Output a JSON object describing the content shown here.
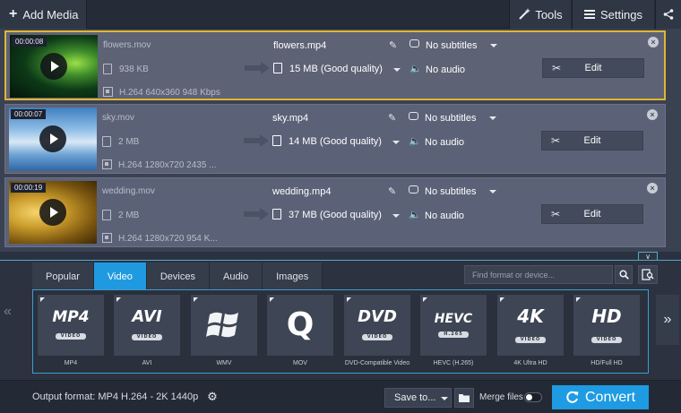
{
  "toolbar": {
    "add_media_label": "Add Media",
    "tools_label": "Tools",
    "settings_label": "Settings"
  },
  "files": [
    {
      "duration": "00:00:08",
      "source_name": "flowers.mov",
      "source_size": "938 KB",
      "source_codec": "H.264 640x360 948 Kbps",
      "output_name": "flowers.mp4",
      "output_size": "15 MB (Good quality)",
      "subtitles": "No subtitles",
      "audio": "No audio",
      "edit_label": "Edit",
      "selected": true
    },
    {
      "duration": "00:00:07",
      "source_name": "sky.mov",
      "source_size": "2 MB",
      "source_codec": "H.264 1280x720 2435 ...",
      "output_name": "sky.mp4",
      "output_size": "14 MB (Good quality)",
      "subtitles": "No subtitles",
      "audio": "No audio",
      "edit_label": "Edit",
      "selected": false
    },
    {
      "duration": "00:00:19",
      "source_name": "wedding.mov",
      "source_size": "2 MB",
      "source_codec": "H.264 1280x720 954 K...",
      "output_name": "wedding.mp4",
      "output_size": "37 MB (Good quality)",
      "subtitles": "No subtitles",
      "audio": "No audio",
      "edit_label": "Edit",
      "selected": false
    }
  ],
  "format_tabs": [
    "Popular",
    "Video",
    "Devices",
    "Audio",
    "Images"
  ],
  "active_tab": "Video",
  "search": {
    "placeholder": "Find format or device..."
  },
  "formats": [
    {
      "logo": "MP4",
      "sub": "VIDEO",
      "label": "MP4"
    },
    {
      "logo": "AVI",
      "sub": "VIDEO",
      "label": "AVI"
    },
    {
      "logo": "",
      "sub": "",
      "label": "WMV"
    },
    {
      "logo": "Q",
      "sub": "",
      "label": "MOV"
    },
    {
      "logo": "DVD",
      "sub": "VIDEO",
      "label": "DVD-Compatible Video"
    },
    {
      "logo": "HEVC",
      "sub": "H.265",
      "label": "HEVC (H.265)"
    },
    {
      "logo": "4K",
      "sub": "VIDEO",
      "label": "4K Ultra HD"
    },
    {
      "logo": "HD",
      "sub": "VIDEO",
      "label": "HD/Full HD"
    }
  ],
  "bottom": {
    "output_format": "Output format: MP4 H.264 - 2K 1440p",
    "save_to_label": "Save to...",
    "merge_label": "Merge files",
    "convert_label": "Convert"
  },
  "colors": {
    "accent": "#1e9be2",
    "selected_border": "#e0b634",
    "row_bg": "#5b6278"
  }
}
